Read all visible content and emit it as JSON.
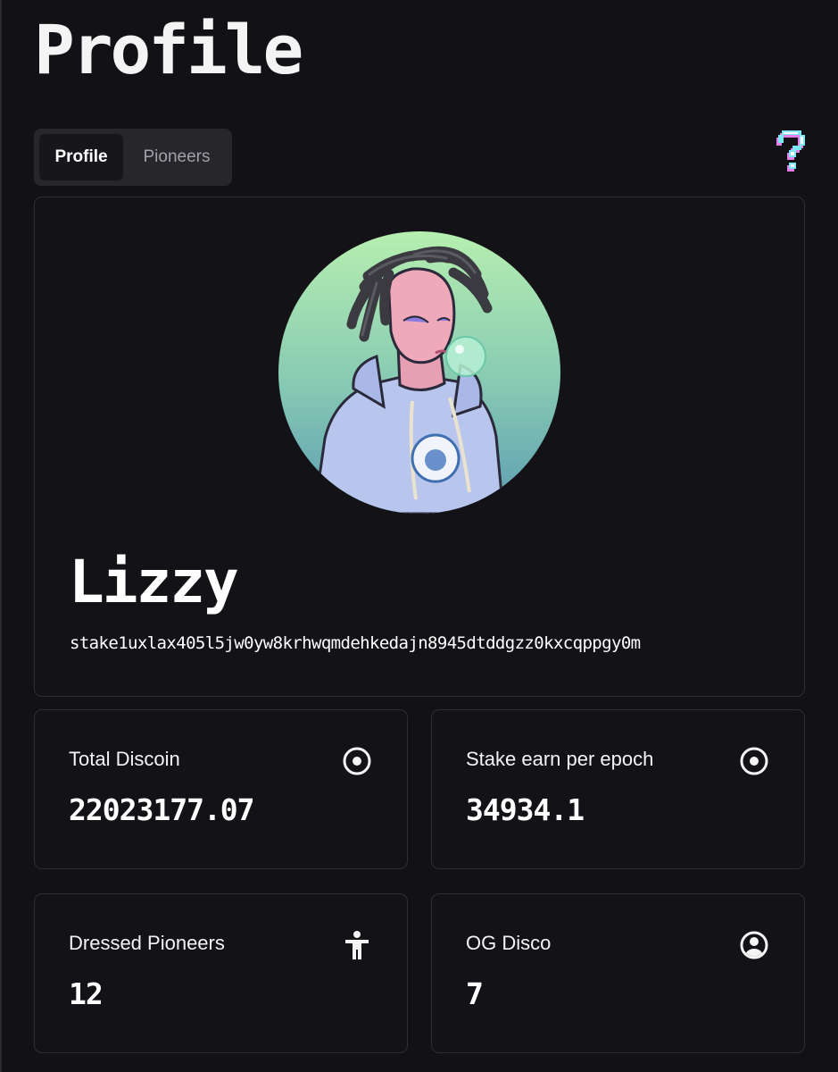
{
  "page": {
    "title": "Profile"
  },
  "tabs": [
    {
      "label": "Profile",
      "active": true
    },
    {
      "label": "Pioneers",
      "active": false
    }
  ],
  "help": {
    "icon": "question-mark-icon"
  },
  "profile": {
    "avatar_alt": "avatar",
    "name": "Lizzy",
    "stake_address": "stake1uxlax405l5jw0yw8krhwqmdehkedajn8945dtddgzz0kxcqppgy0m"
  },
  "stats": [
    {
      "label": "Total Discoin",
      "value": "22023177.07",
      "icon": "coin-icon"
    },
    {
      "label": "Stake earn per epoch",
      "value": "34934.1",
      "icon": "coin-icon"
    },
    {
      "label": "Dressed Pioneers",
      "value": "12",
      "icon": "person-icon"
    },
    {
      "label": "OG Disco",
      "value": "7",
      "icon": "user-circle-icon"
    }
  ],
  "colors": {
    "background": "#121216",
    "card_border": "#2d2d33",
    "tab_bar": "#26262b",
    "text": "#f4f4f5",
    "avatar_gradient_top": "#b6efb0",
    "avatar_gradient_bottom": "#5c9cb3",
    "help_cyan": "#7ee8f2",
    "help_magenta": "#e87ce8"
  }
}
